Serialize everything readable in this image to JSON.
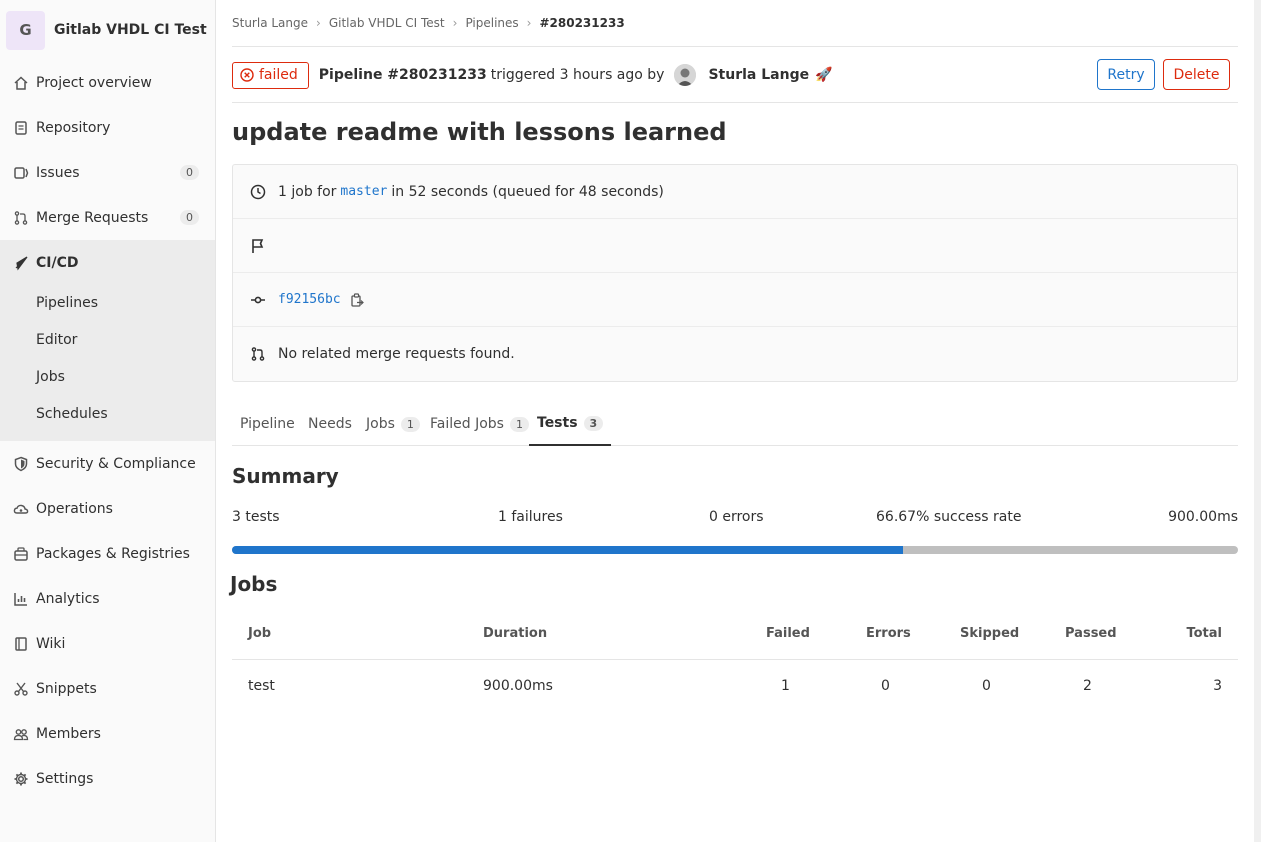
{
  "project": {
    "avatar_letter": "G",
    "name": "Gitlab VHDL CI Test"
  },
  "sidebar": {
    "items": [
      {
        "label": "Project overview",
        "icon": "home-icon"
      },
      {
        "label": "Repository",
        "icon": "document-icon"
      },
      {
        "label": "Issues",
        "icon": "issues-icon",
        "badge": "0"
      },
      {
        "label": "Merge Requests",
        "icon": "merge-request-icon",
        "badge": "0"
      },
      {
        "label": "CI/CD",
        "icon": "rocket-icon"
      },
      {
        "label": "Security & Compliance",
        "icon": "shield-icon"
      },
      {
        "label": "Operations",
        "icon": "cloud-gear-icon"
      },
      {
        "label": "Packages & Registries",
        "icon": "package-icon"
      },
      {
        "label": "Analytics",
        "icon": "chart-icon"
      },
      {
        "label": "Wiki",
        "icon": "book-icon"
      },
      {
        "label": "Snippets",
        "icon": "scissors-icon"
      },
      {
        "label": "Members",
        "icon": "users-icon"
      },
      {
        "label": "Settings",
        "icon": "gear-icon"
      }
    ],
    "cicd_sub": [
      "Pipelines",
      "Editor",
      "Jobs",
      "Schedules"
    ]
  },
  "breadcrumb": [
    "Sturla Lange",
    "Gitlab VHDL CI Test",
    "Pipelines",
    "#280231233"
  ],
  "header": {
    "status": "failed",
    "pipeline": "Pipeline #280231233",
    "triggered": "triggered 3 hours ago by",
    "user": "Sturla Lange",
    "emoji": "🚀",
    "retry": "Retry",
    "delete": "Delete"
  },
  "title": "update readme with lessons learned",
  "info": {
    "jobs_prefix": "1 job for",
    "branch": "master",
    "jobs_suffix": "in 52 seconds (queued for 48 seconds)",
    "commit": "f92156bc",
    "mr": "No related merge requests found."
  },
  "tabs": [
    {
      "label": "Pipeline"
    },
    {
      "label": "Needs"
    },
    {
      "label": "Jobs",
      "count": "1"
    },
    {
      "label": "Failed Jobs",
      "count": "1"
    },
    {
      "label": "Tests",
      "count": "3"
    }
  ],
  "summary": {
    "title": "Summary",
    "tests": "3 tests",
    "failures": "1 failures",
    "errors": "0 errors",
    "success_rate": "66.67% success rate",
    "duration": "900.00ms",
    "success_fraction": 0.6667
  },
  "jobs": {
    "title": "Jobs",
    "headers": [
      "Job",
      "Duration",
      "Failed",
      "Errors",
      "Skipped",
      "Passed",
      "Total"
    ],
    "rows": [
      [
        "test",
        "900.00ms",
        "1",
        "0",
        "0",
        "2",
        "3"
      ]
    ]
  }
}
